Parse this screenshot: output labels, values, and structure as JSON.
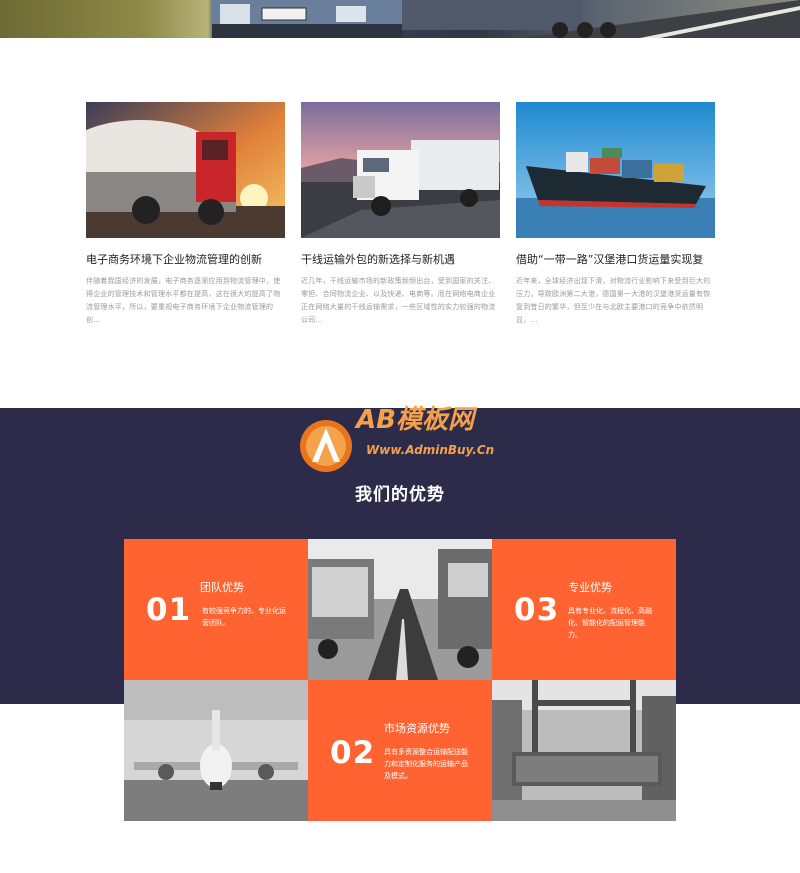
{
  "news": {
    "items": [
      {
        "title": "电子商务环境下企业物流管理的创新",
        "desc": "伴随着我国经济的发展，电子商务逐渐应用到物流管理中，使得企业的管理技术和管理水平都在提高，这在很大的提高了物流管理水平，所以，要重视电子商务环境下企业物流管理的创..."
      },
      {
        "title": "干线运输外包的新选择与新机遇",
        "desc": "近几年，干线运输市场的新政策频频出台，受到国家的关注、零担、合同物流企业、以及快递、电商等。而在网络电商企业正在网络大量的干线运输需求，一些区域性的实力较强的物流公司..."
      },
      {
        "title": "借助“一带一路”汉堡港口货运量实现复",
        "desc": "近年来，全球经济出现下滑，对物流行业影响下来受到巨大的压力，导致欧洲第二大港，德国第一大港的汉堡港货运量有恢复到昔日的繁华，但至少在与北欧主要港口的竞争中依然明显，..."
      }
    ]
  },
  "logo": {
    "main": "AB模板网",
    "sub": "Www.AdminBuy.Cn"
  },
  "advantages": {
    "title": "我们的优势",
    "items": [
      {
        "num": "01",
        "title": "团队优势",
        "desc": "有较强竞争力的、专业化运营团队。"
      },
      {
        "num": "03",
        "title": "专业优势",
        "desc": "具有专业化、流程化、高融化、智能化的配运管理能力。"
      },
      {
        "num": "02",
        "title": "市场资源优势",
        "desc": "具有多资源整合运输配送能力和定制化服务的运输产品及模式。"
      }
    ]
  },
  "colors": {
    "accent": "#ff6331",
    "navy": "#2c2b4a"
  }
}
